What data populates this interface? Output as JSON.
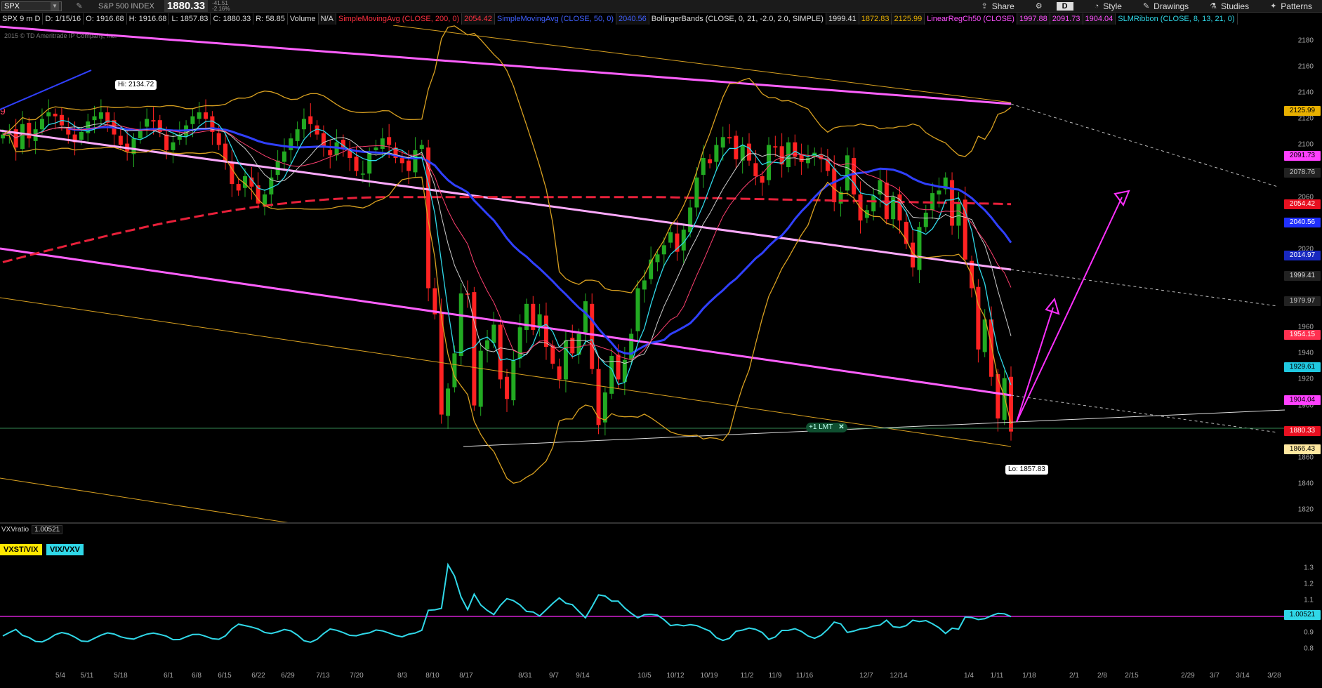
{
  "toolbar": {
    "symbol": "SPX",
    "index_name": "S&P 500 INDEX",
    "last_price": "1880.33",
    "change": "-41.51",
    "change_pct": "-2.16%",
    "share": "Share",
    "aggregation": "D",
    "style": "Style",
    "drawings": "Drawings",
    "studies": "Studies",
    "patterns": "Patterns"
  },
  "studybar": {
    "chart_label": "SPX 9 m D",
    "date": "D: 1/15/16",
    "open": "O: 1916.68",
    "high": "H: 1916.68",
    "low": "L: 1857.83",
    "close": "C: 1880.33",
    "range": "R: 58.85",
    "volume_label": "Volume",
    "volume_value": "N/A",
    "sma200_label": "SimpleMovingAvg (CLOSE, 200, 0)",
    "sma200_value": "2054.42",
    "sma50_label": "SimpleMovingAvg (CLOSE, 50, 0)",
    "sma50_value": "2040.56",
    "bb_label": "BollingerBands (CLOSE, 0, 21, -2.0, 2.0, SIMPLE)",
    "bb_mid": "1999.41",
    "bb_low": "1872.83",
    "bb_up": "2125.99",
    "lrc_label": "LinearRegCh50 (CLOSE)",
    "lrc_1": "1997.88",
    "lrc_2": "2091.73",
    "lrc_3": "1904.04",
    "slm_label": "SLMRibbon (CLOSE, 8, 13, 21, 0)"
  },
  "copyright": "2015 © TD Ameritrade IP Company, Inc.",
  "colors": {
    "up": "#22aa22",
    "down": "#ff2222",
    "sma200": "#e8203a",
    "sma50": "#3040ff",
    "bollinger": "#d8a020",
    "regression": "#ff60ff",
    "regression_mid": "#ffaaff",
    "vix_line": "#30d8e8",
    "threshold": "#d020d0"
  },
  "price_axis": {
    "ticks": [
      "2180",
      "2160",
      "2140",
      "2120",
      "2100",
      "2080",
      "2060",
      "2040",
      "2020",
      "2000",
      "1980",
      "1960",
      "1940",
      "1920",
      "1900",
      "1880",
      "1860",
      "1840",
      "1820"
    ],
    "tags": [
      {
        "value": "2125.99",
        "bg": "#e8b000",
        "fg": "#000"
      },
      {
        "value": "2091.73",
        "bg": "#ff40ff",
        "fg": "#000"
      },
      {
        "value": "2078.76",
        "bg": "#222",
        "fg": "#ccc"
      },
      {
        "value": "2054.42",
        "bg": "#e81020",
        "fg": "#fff"
      },
      {
        "value": "2040.56",
        "bg": "#2030ff",
        "fg": "#fff"
      },
      {
        "value": "2014.97",
        "bg": "#1828c0",
        "fg": "#fff"
      },
      {
        "value": "1999.41",
        "bg": "#222",
        "fg": "#ddd"
      },
      {
        "value": "1979.97",
        "bg": "#222",
        "fg": "#ccc"
      },
      {
        "value": "1954.15",
        "bg": "#ff3050",
        "fg": "#fff"
      },
      {
        "value": "1929.61",
        "bg": "#20c8e0",
        "fg": "#000"
      },
      {
        "value": "1904.04",
        "bg": "#ff40ff",
        "fg": "#000"
      },
      {
        "value": "1880.33",
        "bg": "#e81020",
        "fg": "#fff"
      },
      {
        "value": "1866.43",
        "bg": "#ffe8a0",
        "fg": "#000"
      }
    ]
  },
  "annotations": {
    "hi": "Hi: 2134.72",
    "lo": "Lo: 1857.83",
    "order": "+1 LMT",
    "order_close": "✕",
    "left_edge_marker": "9"
  },
  "lower": {
    "study_name": "VXVratio",
    "study_value": "1.00521",
    "legend1": "VXST/VIX",
    "legend2": "VIX/VXV",
    "ticks": [
      "1.3",
      "1.2",
      "1.1",
      "1.0",
      "0.9",
      "0.8"
    ],
    "value_tag": "1.00521",
    "threshold": 1.0
  },
  "x_axis": [
    "5/4",
    "5/11",
    "5/18",
    "6/1",
    "6/8",
    "6/15",
    "6/22",
    "6/29",
    "7/13",
    "7/20",
    "8/3",
    "8/10",
    "8/17",
    "8/31",
    "9/7",
    "9/14",
    "10/5",
    "10/12",
    "10/19",
    "11/2",
    "11/9",
    "11/16",
    "12/7",
    "12/14",
    "1/4",
    "1/11",
    "1/18",
    "2/1",
    "2/8",
    "2/15",
    "2/29",
    "3/7",
    "3/14",
    "3/28"
  ],
  "chart_data": {
    "type": "candlestick",
    "series_note": "SPX daily, May 2015 – Jan 15 2016",
    "closes": [
      2108,
      2110,
      2098,
      2116,
      2105,
      2112,
      2120,
      2125,
      2122,
      2115,
      2108,
      2102,
      2110,
      2118,
      2122,
      2125,
      2117,
      2108,
      2100,
      2095,
      2105,
      2112,
      2120,
      2118,
      2110,
      2096,
      2102,
      2108,
      2115,
      2122,
      2125,
      2120,
      2110,
      2100,
      2088,
      2070,
      2065,
      2076,
      2068,
      2055,
      2062,
      2075,
      2088,
      2095,
      2105,
      2112,
      2120,
      2116,
      2108,
      2098,
      2092,
      2102,
      2098,
      2090,
      2080,
      2078,
      2094,
      2098,
      2105,
      2100,
      2090,
      2086,
      2080,
      2096,
      2100,
      1990,
      1970,
      1893,
      1913,
      1940,
      1986,
      1985,
      1900,
      1942,
      1950,
      1962,
      1920,
      1905,
      1935,
      1960,
      1978,
      1958,
      1970,
      1945,
      1932,
      1920,
      1950,
      1940,
      1955,
      1980,
      1928,
      1885,
      1910,
      1938,
      1920,
      1935,
      1955,
      1990,
      1996,
      2012,
      2016,
      2023,
      2033,
      2018,
      2035,
      2052,
      2075,
      2090,
      2086,
      2100,
      2106,
      2105,
      2089,
      2100,
      2088,
      2076,
      2071,
      2100,
      2098,
      2085,
      2102,
      2091,
      2087,
      2090,
      2094,
      2089,
      2080,
      2056,
      2064,
      2092,
      2062,
      2042,
      2050,
      2061,
      2073,
      2043,
      2060,
      2042,
      2024,
      2006,
      2037,
      2048,
      2063,
      2065,
      2075,
      2038,
      2056,
      2012,
      1990,
      1943,
      1966,
      1922,
      1890,
      1921,
      1880
    ]
  }
}
